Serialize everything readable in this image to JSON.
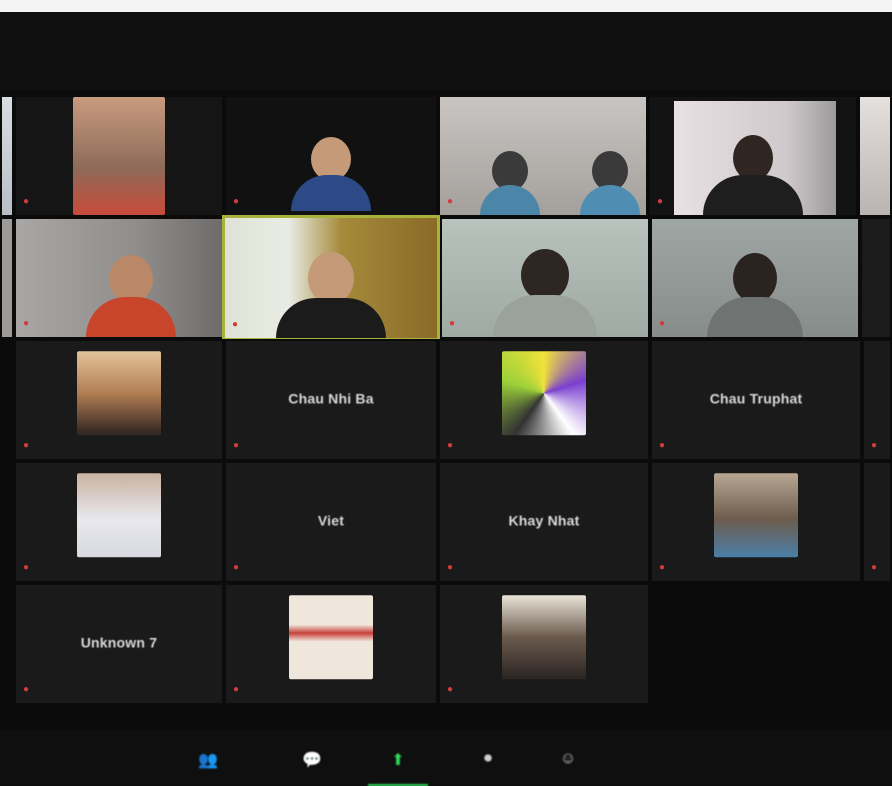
{
  "meeting": {
    "participants": [
      {
        "id": "p1",
        "display_name": "",
        "label": "",
        "video": true
      },
      {
        "id": "p2",
        "display_name": "",
        "label": "",
        "video": true
      },
      {
        "id": "p3",
        "display_name": "",
        "label": "",
        "video": true
      },
      {
        "id": "p4",
        "display_name": "",
        "label": "",
        "video": true
      },
      {
        "id": "p5",
        "display_name": "",
        "label": "",
        "video": true
      },
      {
        "id": "p6",
        "display_name": "",
        "label": "",
        "video": true
      },
      {
        "id": "p7",
        "display_name": "",
        "label": "",
        "video": true
      },
      {
        "id": "p8",
        "display_name": "",
        "label": "",
        "video": true
      },
      {
        "id": "p9",
        "display_name": "",
        "label": "",
        "video": true
      },
      {
        "id": "p10",
        "display_name": "Chau Nhi Ba",
        "label": "",
        "video": false
      },
      {
        "id": "p11",
        "display_name": "",
        "label": "",
        "video": true
      },
      {
        "id": "p12",
        "display_name": "Chau Truphat",
        "label": "",
        "video": false
      },
      {
        "id": "p13",
        "display_name": "",
        "label": "",
        "video": true
      },
      {
        "id": "p14",
        "display_name": "Viet",
        "label": "",
        "video": false
      },
      {
        "id": "p15",
        "display_name": "Khay Nhat",
        "label": "",
        "video": false
      },
      {
        "id": "p16",
        "display_name": "",
        "label": "",
        "video": true
      },
      {
        "id": "p17",
        "display_name": "Unknown 7",
        "label": "",
        "video": false
      },
      {
        "id": "p18",
        "display_name": "",
        "label": "",
        "video": true
      },
      {
        "id": "p19",
        "display_name": "",
        "label": "",
        "video": true
      }
    ]
  },
  "toolbar": {
    "items": [
      {
        "id": "participants",
        "icon": "participants-icon",
        "caption": ""
      },
      {
        "id": "chat",
        "icon": "chat-icon",
        "caption": ""
      },
      {
        "id": "share-screen",
        "icon": "share-screen-icon",
        "caption": ""
      },
      {
        "id": "record",
        "icon": "record-icon",
        "caption": ""
      },
      {
        "id": "reactions",
        "icon": "reactions-icon",
        "caption": ""
      }
    ]
  },
  "colors": {
    "background": "#0b0b0b",
    "tile": "#1a1a1a",
    "active_speaker_border": "#a8b23a",
    "muted_icon": "#d23b3b",
    "share_accent": "#2fd85a"
  }
}
